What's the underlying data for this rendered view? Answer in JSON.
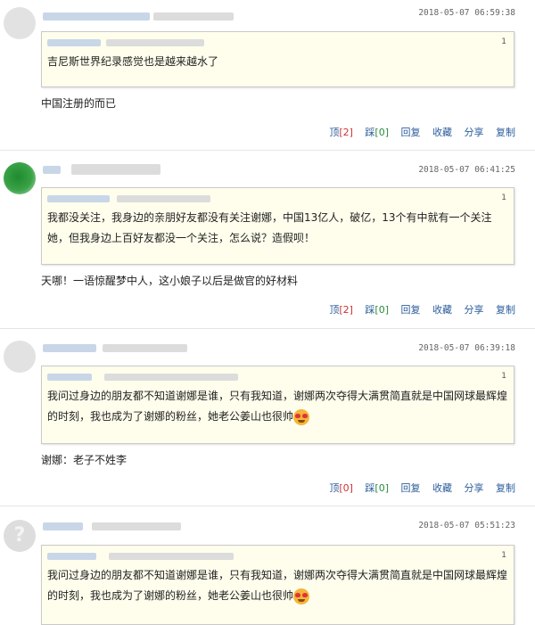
{
  "comments": [
    {
      "time": "2018-05-07 06:59:38",
      "quote_num": "1",
      "quote_text": "吉尼斯世界纪录感觉也是越来越水了",
      "reply": "中国注册的而已",
      "actions": {
        "ding_label": "顶",
        "ding_count": "[2]",
        "cai_label": "踩",
        "cai_count": "[0]",
        "reply": "回复",
        "fav": "收藏",
        "share": "分享",
        "copy": "复制"
      }
    },
    {
      "time": "2018-05-07 06:41:25",
      "quote_num": "1",
      "quote_text": "我都没关注，我身边的亲朋好友都没有关注谢娜，中国13亿人，破亿，13个有中就有一个关注她，但我身边上百好友都没一个关注，怎么说？造假呗！",
      "reply": "天哪！一语惊醒梦中人，这小娘子以后是做官的好材料",
      "actions": {
        "ding_label": "顶",
        "ding_count": "[2]",
        "cai_label": "踩",
        "cai_count": "[0]",
        "reply": "回复",
        "fav": "收藏",
        "share": "分享",
        "copy": "复制"
      }
    },
    {
      "time": "2018-05-07 06:39:18",
      "quote_num": "1",
      "quote_text": "我问过身边的朋友都不知道谢娜是谁，只有我知道，谢娜两次夺得大满贯简直就是中国网球最辉煌的时刻，我也成为了谢娜的粉丝，她老公姜山也很帅",
      "reply": "谢娜：老子不姓李",
      "actions": {
        "ding_label": "顶",
        "ding_count": "[0]",
        "cai_label": "踩",
        "cai_count": "[0]",
        "reply": "回复",
        "fav": "收藏",
        "share": "分享",
        "copy": "复制"
      }
    },
    {
      "time": "2018-05-07 05:51:23",
      "quote_num": "1",
      "quote_text": "我问过身边的朋友都不知道谢娜是谁，只有我知道，谢娜两次夺得大满贯简直就是中国网球最辉煌的时刻，我也成为了谢娜的粉丝，她老公姜山也很帅"
    }
  ]
}
